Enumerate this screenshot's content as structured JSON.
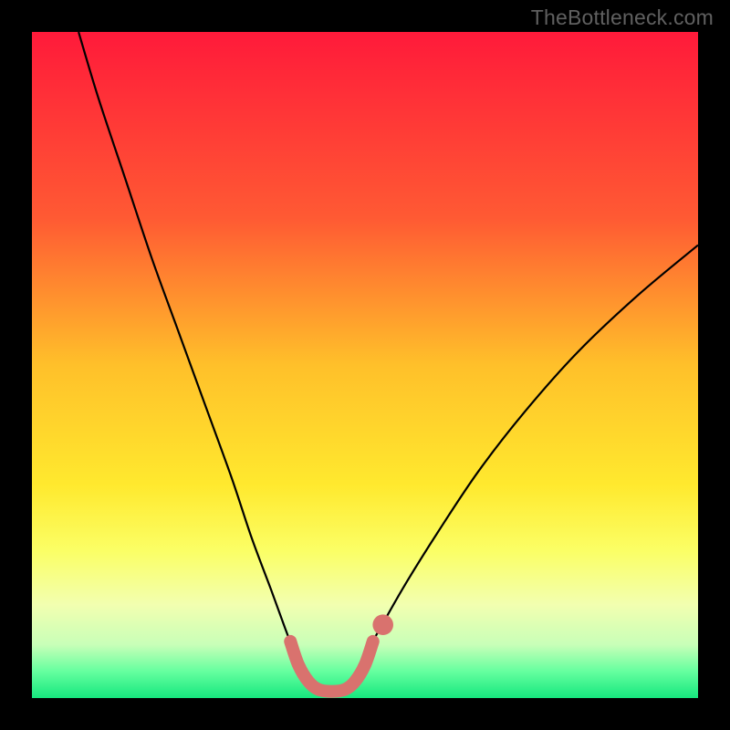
{
  "watermark": "TheBottleneck.com",
  "chart_data": {
    "type": "line",
    "title": "",
    "xlabel": "",
    "ylabel": "",
    "xlim": [
      0,
      100
    ],
    "ylim": [
      0,
      100
    ],
    "gradient_stops": [
      {
        "offset": 0,
        "color": "#ff1a3a"
      },
      {
        "offset": 28,
        "color": "#ff5a33"
      },
      {
        "offset": 50,
        "color": "#ffc02a"
      },
      {
        "offset": 68,
        "color": "#ffe92e"
      },
      {
        "offset": 78,
        "color": "#fbff66"
      },
      {
        "offset": 86,
        "color": "#f2ffb0"
      },
      {
        "offset": 92,
        "color": "#c8ffb8"
      },
      {
        "offset": 96,
        "color": "#65ff9f"
      },
      {
        "offset": 100,
        "color": "#16e77e"
      }
    ],
    "series": [
      {
        "name": "left-branch",
        "style": "thin-black",
        "points": [
          {
            "x": 7.0,
            "y": 100.0
          },
          {
            "x": 10.0,
            "y": 90.0
          },
          {
            "x": 14.0,
            "y": 78.0
          },
          {
            "x": 18.0,
            "y": 66.0
          },
          {
            "x": 22.0,
            "y": 55.0
          },
          {
            "x": 26.0,
            "y": 44.0
          },
          {
            "x": 30.0,
            "y": 33.0
          },
          {
            "x": 33.0,
            "y": 24.0
          },
          {
            "x": 36.0,
            "y": 16.0
          },
          {
            "x": 38.0,
            "y": 10.5
          },
          {
            "x": 39.5,
            "y": 6.5
          }
        ]
      },
      {
        "name": "right-branch",
        "style": "thin-black",
        "points": [
          {
            "x": 50.0,
            "y": 6.5
          },
          {
            "x": 52.0,
            "y": 10.0
          },
          {
            "x": 56.0,
            "y": 17.0
          },
          {
            "x": 61.0,
            "y": 25.0
          },
          {
            "x": 67.0,
            "y": 34.0
          },
          {
            "x": 74.0,
            "y": 43.0
          },
          {
            "x": 82.0,
            "y": 52.0
          },
          {
            "x": 91.0,
            "y": 60.5
          },
          {
            "x": 100.0,
            "y": 68.0
          }
        ]
      },
      {
        "name": "bottom-highlight",
        "style": "thick-salmon",
        "points": [
          {
            "x": 38.8,
            "y": 8.5
          },
          {
            "x": 40.0,
            "y": 5.0
          },
          {
            "x": 41.5,
            "y": 2.5
          },
          {
            "x": 43.0,
            "y": 1.3
          },
          {
            "x": 45.0,
            "y": 1.0
          },
          {
            "x": 47.0,
            "y": 1.3
          },
          {
            "x": 48.5,
            "y": 2.5
          },
          {
            "x": 50.0,
            "y": 5.0
          },
          {
            "x": 51.2,
            "y": 8.5
          }
        ]
      }
    ],
    "markers": [
      {
        "x": 52.7,
        "y": 11.0,
        "color": "#d9726e",
        "r": 1.0
      }
    ]
  }
}
